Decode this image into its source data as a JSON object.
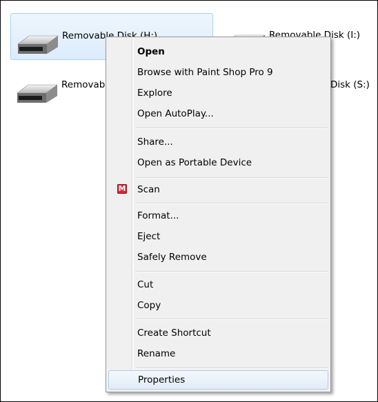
{
  "drives": [
    {
      "label": "Removable Disk (H:)",
      "icon": "removable-disk-icon"
    },
    {
      "label": "Removable Disk (I:)",
      "icon": "removable-disk-icon"
    },
    {
      "label": "Removab",
      "icon": "removable-disk-icon"
    },
    {
      "label": "Disk (S:)",
      "icon": "removable-disk-icon"
    }
  ],
  "menu": {
    "open": "Open",
    "browse_psp": "Browse with Paint Shop Pro 9",
    "explore": "Explore",
    "open_autoplay": "Open AutoPlay...",
    "share": "Share...",
    "open_portable": "Open as Portable Device",
    "scan": "Scan",
    "scan_icon_letter": "M",
    "format": "Format...",
    "eject": "Eject",
    "safely_remove": "Safely Remove",
    "cut": "Cut",
    "copy": "Copy",
    "create_shortcut": "Create Shortcut",
    "rename": "Rename",
    "properties": "Properties"
  },
  "colors": {
    "selection": "#dcecfb",
    "menu_background": "#f0f0f0",
    "mcafee_red": "#e02030"
  }
}
